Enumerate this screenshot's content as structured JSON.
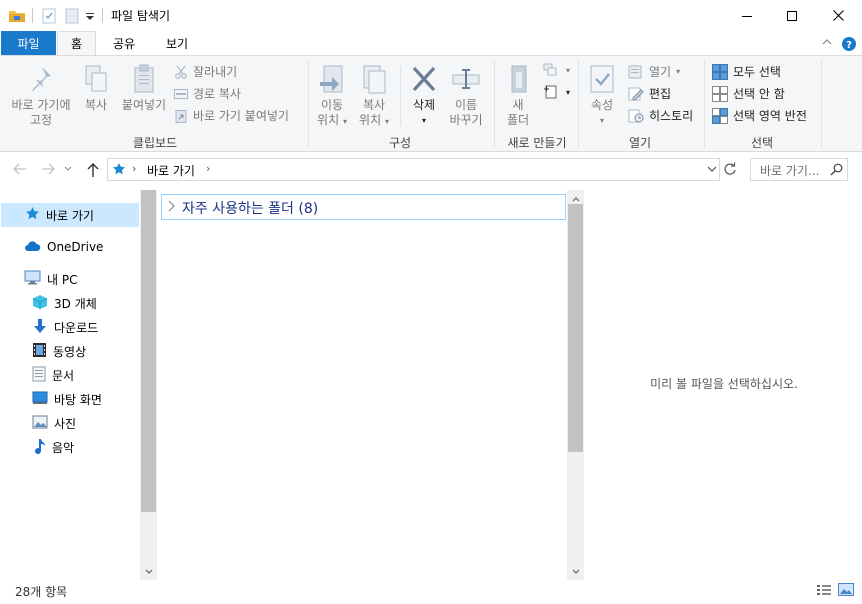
{
  "titlebar": {
    "title": "파일 탐색기",
    "minimize_icon": "minimize-icon",
    "maximize_icon": "maximize-icon",
    "close_icon": "close-icon"
  },
  "tabs": [
    {
      "label": "파일"
    },
    {
      "label": "홈"
    },
    {
      "label": "공유"
    },
    {
      "label": "보기"
    }
  ],
  "ribbon": {
    "clipboard": {
      "pin_line1": "바로 가기에",
      "pin_line2": "고정",
      "copy": "복사",
      "paste": "붙여넣기",
      "cut": "잘라내기",
      "copy_path": "경로 복사",
      "paste_shortcut": "바로 가기 붙여넣기",
      "label": "클립보드"
    },
    "organize": {
      "move_line1": "이동",
      "move_line2": "위치",
      "copyto_line1": "복사",
      "copyto_line2": "위치",
      "delete": "삭제",
      "rename_line1": "이름",
      "rename_line2": "바꾸기",
      "label": "구성"
    },
    "new": {
      "folder_line1": "새",
      "folder_line2": "폴더",
      "label": "새로 만들기"
    },
    "open": {
      "properties": "속성",
      "open": "열기",
      "edit": "편집",
      "history": "히스토리",
      "label": "열기"
    },
    "select": {
      "all": "모두 선택",
      "none": "선택 안 함",
      "invert": "선택 영역 반전",
      "label": "선택"
    }
  },
  "address": {
    "path": "바로 가기",
    "search_placeholder": "바로 가기..."
  },
  "navpane": {
    "items": [
      {
        "label": "바로 가기",
        "icon": "star-icon"
      },
      {
        "label": "OneDrive",
        "icon": "cloud-icon"
      },
      {
        "label": "내 PC",
        "icon": "pc-icon"
      },
      {
        "label": "3D 개체",
        "icon": "cube-icon"
      },
      {
        "label": "다운로드",
        "icon": "download-icon"
      },
      {
        "label": "동영상",
        "icon": "video-icon"
      },
      {
        "label": "문서",
        "icon": "document-icon"
      },
      {
        "label": "바탕 화면",
        "icon": "desktop-icon"
      },
      {
        "label": "사진",
        "icon": "picture-icon"
      },
      {
        "label": "음악",
        "icon": "music-icon"
      }
    ]
  },
  "content": {
    "group_title": "자주 사용하는 폴더 (8)",
    "preview_message": "미리 볼 파일을 선택하십시오."
  },
  "status": {
    "item_count": "28개 항목"
  },
  "colors": {
    "accent": "#1979ca",
    "selection": "#cce8ff",
    "ribbon_bg": "#f5f6f7",
    "group_title": "#1e3287"
  }
}
